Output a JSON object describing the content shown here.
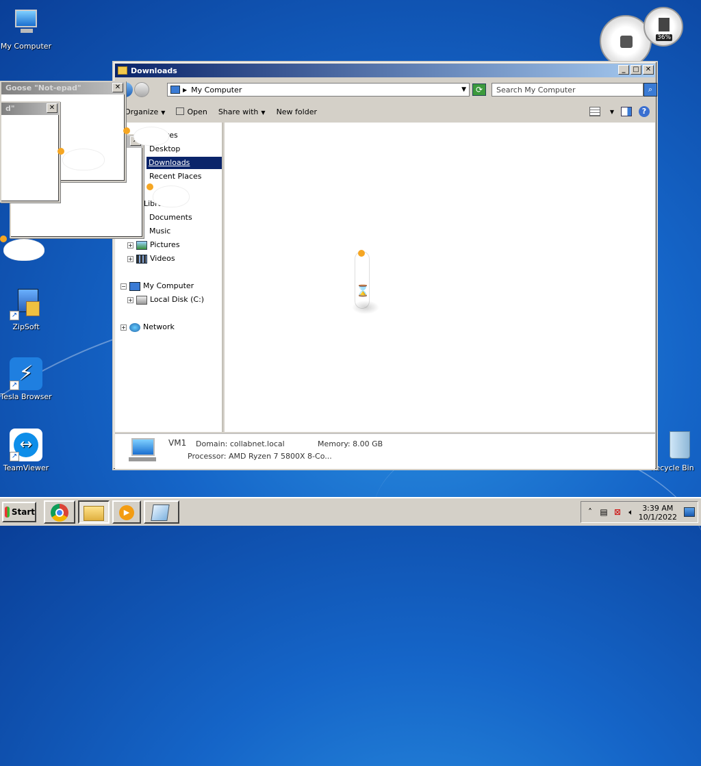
{
  "desktop": {
    "icons": [
      {
        "label": "My Computer"
      },
      {
        "label": "ZipSoft"
      },
      {
        "label": "Tesla Browser"
      },
      {
        "label": "TeamViewer"
      },
      {
        "label": "Recycle Bin"
      }
    ]
  },
  "gadgets": {
    "cpu_percent": "36%"
  },
  "goose_windows": {
    "title1": "Goose \"Not-epad\"",
    "title2": "d\""
  },
  "explorer": {
    "title": "Downloads",
    "address": "My Computer",
    "search_placeholder": "Search My Computer",
    "toolbar": {
      "organize": "Organize",
      "open": "Open",
      "share_with": "Share with",
      "new_folder": "New folder"
    },
    "nav": {
      "favorites": "Favorites",
      "desktop": "Desktop",
      "downloads": "Downloads",
      "recent_places": "Recent Places",
      "libraries": "Libraries",
      "documents": "Documents",
      "music": "Music",
      "pictures": "Pictures",
      "videos": "Videos",
      "my_computer": "My Computer",
      "local_disk": "Local Disk (C:)",
      "network": "Network"
    },
    "details": {
      "name": "VM1",
      "domain": "Domain: collabnet.local",
      "memory": "Memory: 8.00 GB",
      "processor": "Processor: AMD Ryzen 7 5800X 8-Co..."
    }
  },
  "taskbar": {
    "start": "Start",
    "time": "3:39 AM",
    "date": "10/1/2022"
  },
  "colors": {
    "title_active": "#0a246a",
    "selection": "#0a246a",
    "desktop_blue": "#1565c8"
  }
}
